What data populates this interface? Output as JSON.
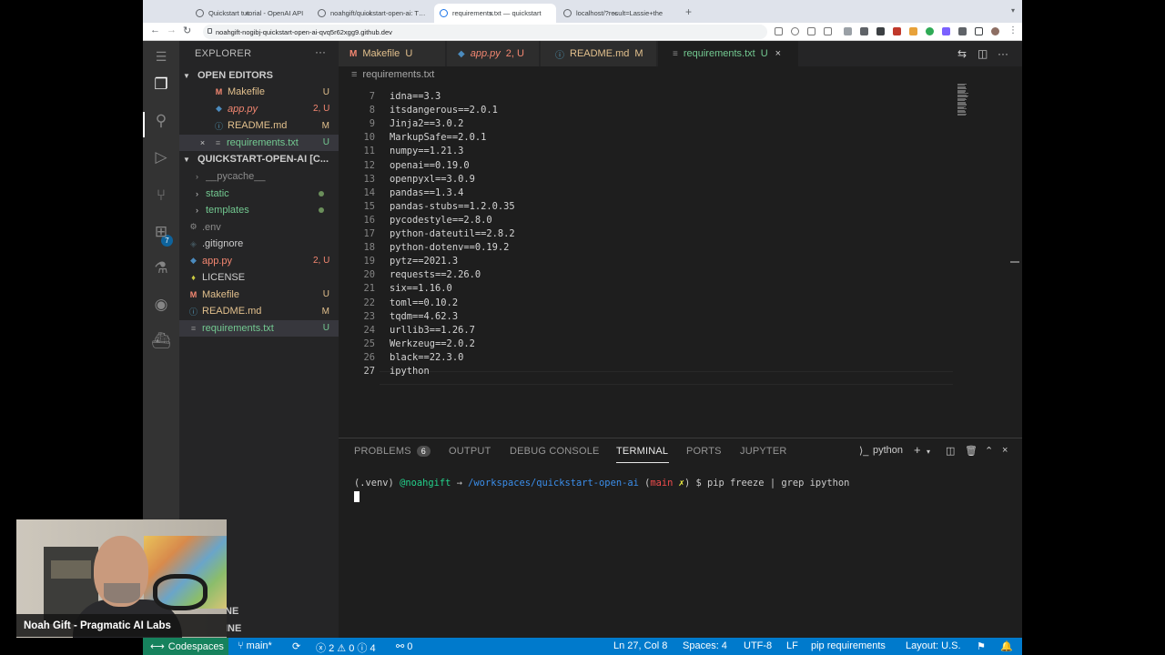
{
  "browser": {
    "tabs": [
      {
        "title": "Quickstart tutorial - OpenAI API",
        "active": false
      },
      {
        "title": "noahgift/quickstart-open-ai: This",
        "active": false
      },
      {
        "title": "requirements.txt — quickstart",
        "active": true
      },
      {
        "title": "localhost/?result=Lassie+the",
        "active": false
      }
    ],
    "new_tab": "+",
    "url": "noahgift-nogibj-quickstart-open-ai-qvq5r62xgg9.github.dev"
  },
  "sidebar": {
    "header": "EXPLORER",
    "more": "···",
    "open_editors_label": "OPEN EDITORS",
    "open_editors": [
      {
        "icon": "M",
        "label": "Makefile",
        "status": "U",
        "color": "yellow"
      },
      {
        "icon": "py",
        "label": "app.py",
        "status": "2, U",
        "color": "red"
      },
      {
        "icon": "i",
        "label": "README.md",
        "status": "M",
        "color": "yellow"
      },
      {
        "icon": "≡",
        "label": "requirements.txt",
        "status": "U",
        "color": "green"
      }
    ],
    "project_label": "QUICKSTART-OPEN-AI [C...",
    "files": [
      {
        "icon": "›",
        "label": "__pycache__",
        "status": "",
        "color": "grey"
      },
      {
        "icon": "›",
        "label": "static",
        "status": "dot",
        "color": "green"
      },
      {
        "icon": "›",
        "label": "templates",
        "status": "dot",
        "color": "green"
      },
      {
        "icon": "⚙",
        "label": ".env",
        "status": "",
        "color": "grey"
      },
      {
        "icon": "◈",
        "label": ".gitignore",
        "status": "",
        "color": "plain"
      },
      {
        "icon": "py",
        "label": "app.py",
        "status": "2, U",
        "color": "red"
      },
      {
        "icon": "♦",
        "label": "LICENSE",
        "status": "",
        "color": "plain"
      },
      {
        "icon": "M",
        "label": "Makefile",
        "status": "U",
        "color": "yellow"
      },
      {
        "icon": "i",
        "label": "README.md",
        "status": "M",
        "color": "yellow"
      },
      {
        "icon": "≡",
        "label": "requirements.txt",
        "status": "U",
        "color": "green"
      }
    ],
    "outline_label": "NE",
    "timeline_label": "INE"
  },
  "editor": {
    "tabs": [
      {
        "icon": "M",
        "label": "Makefile",
        "status": "U",
        "active": false
      },
      {
        "icon": "py",
        "label": "app.py",
        "status": "2, U",
        "active": false
      },
      {
        "icon": "i",
        "label": "README.md",
        "status": "M",
        "active": false
      },
      {
        "icon": "≡",
        "label": "requirements.txt",
        "status": "U",
        "active": true,
        "close": "×"
      }
    ],
    "breadcrumb": "requirements.txt",
    "lines": [
      {
        "n": "7",
        "t": "idna==3.3"
      },
      {
        "n": "8",
        "t": "itsdangerous==2.0.1"
      },
      {
        "n": "9",
        "t": "Jinja2==3.0.2"
      },
      {
        "n": "10",
        "t": "MarkupSafe==2.0.1"
      },
      {
        "n": "11",
        "t": "numpy==1.21.3"
      },
      {
        "n": "12",
        "t": "openai==0.19.0"
      },
      {
        "n": "13",
        "t": "openpyxl==3.0.9"
      },
      {
        "n": "14",
        "t": "pandas==1.3.4"
      },
      {
        "n": "15",
        "t": "pandas-stubs==1.2.0.35"
      },
      {
        "n": "16",
        "t": "pycodestyle==2.8.0"
      },
      {
        "n": "17",
        "t": "python-dateutil==2.8.2"
      },
      {
        "n": "18",
        "t": "python-dotenv==0.19.2"
      },
      {
        "n": "19",
        "t": "pytz==2021.3"
      },
      {
        "n": "20",
        "t": "requests==2.26.0"
      },
      {
        "n": "21",
        "t": "six==1.16.0"
      },
      {
        "n": "22",
        "t": "toml==0.10.2"
      },
      {
        "n": "23",
        "t": "tqdm==4.62.3"
      },
      {
        "n": "24",
        "t": "urllib3==1.26.7"
      },
      {
        "n": "25",
        "t": "Werkzeug==2.0.2"
      },
      {
        "n": "26",
        "t": "black==22.3.0"
      },
      {
        "n": "27",
        "t": "ipython"
      }
    ]
  },
  "panel": {
    "tabs": [
      {
        "label": "PROBLEMS",
        "badge": "6",
        "active": false
      },
      {
        "label": "OUTPUT",
        "active": false
      },
      {
        "label": "DEBUG CONSOLE",
        "active": false
      },
      {
        "label": "TERMINAL",
        "active": true
      },
      {
        "label": "PORTS",
        "active": false
      },
      {
        "label": "JUPYTER",
        "active": false
      }
    ],
    "terminal_name": "python",
    "prompt_env": "(.venv)",
    "prompt_user": "@noahgift",
    "prompt_arrow": "→",
    "prompt_path": "/workspaces/quickstart-open-ai",
    "prompt_branch_open": "(",
    "prompt_branch": "main",
    "prompt_dirty": "✗",
    "prompt_branch_close": ")",
    "prompt_dollar": "$",
    "command": "pip freeze | grep ipython"
  },
  "status": {
    "codespaces": "Codespaces",
    "branch": "main*",
    "errors": "2",
    "warnings": "0",
    "info": "4",
    "ports": "0",
    "position": "Ln 27, Col 8",
    "spaces": "Spaces: 4",
    "encoding": "UTF-8",
    "eol": "LF",
    "language": "pip requirements",
    "layout": "Layout: U.S."
  },
  "webcam": {
    "label": "Noah Gift - Pragmatic AI Labs"
  }
}
